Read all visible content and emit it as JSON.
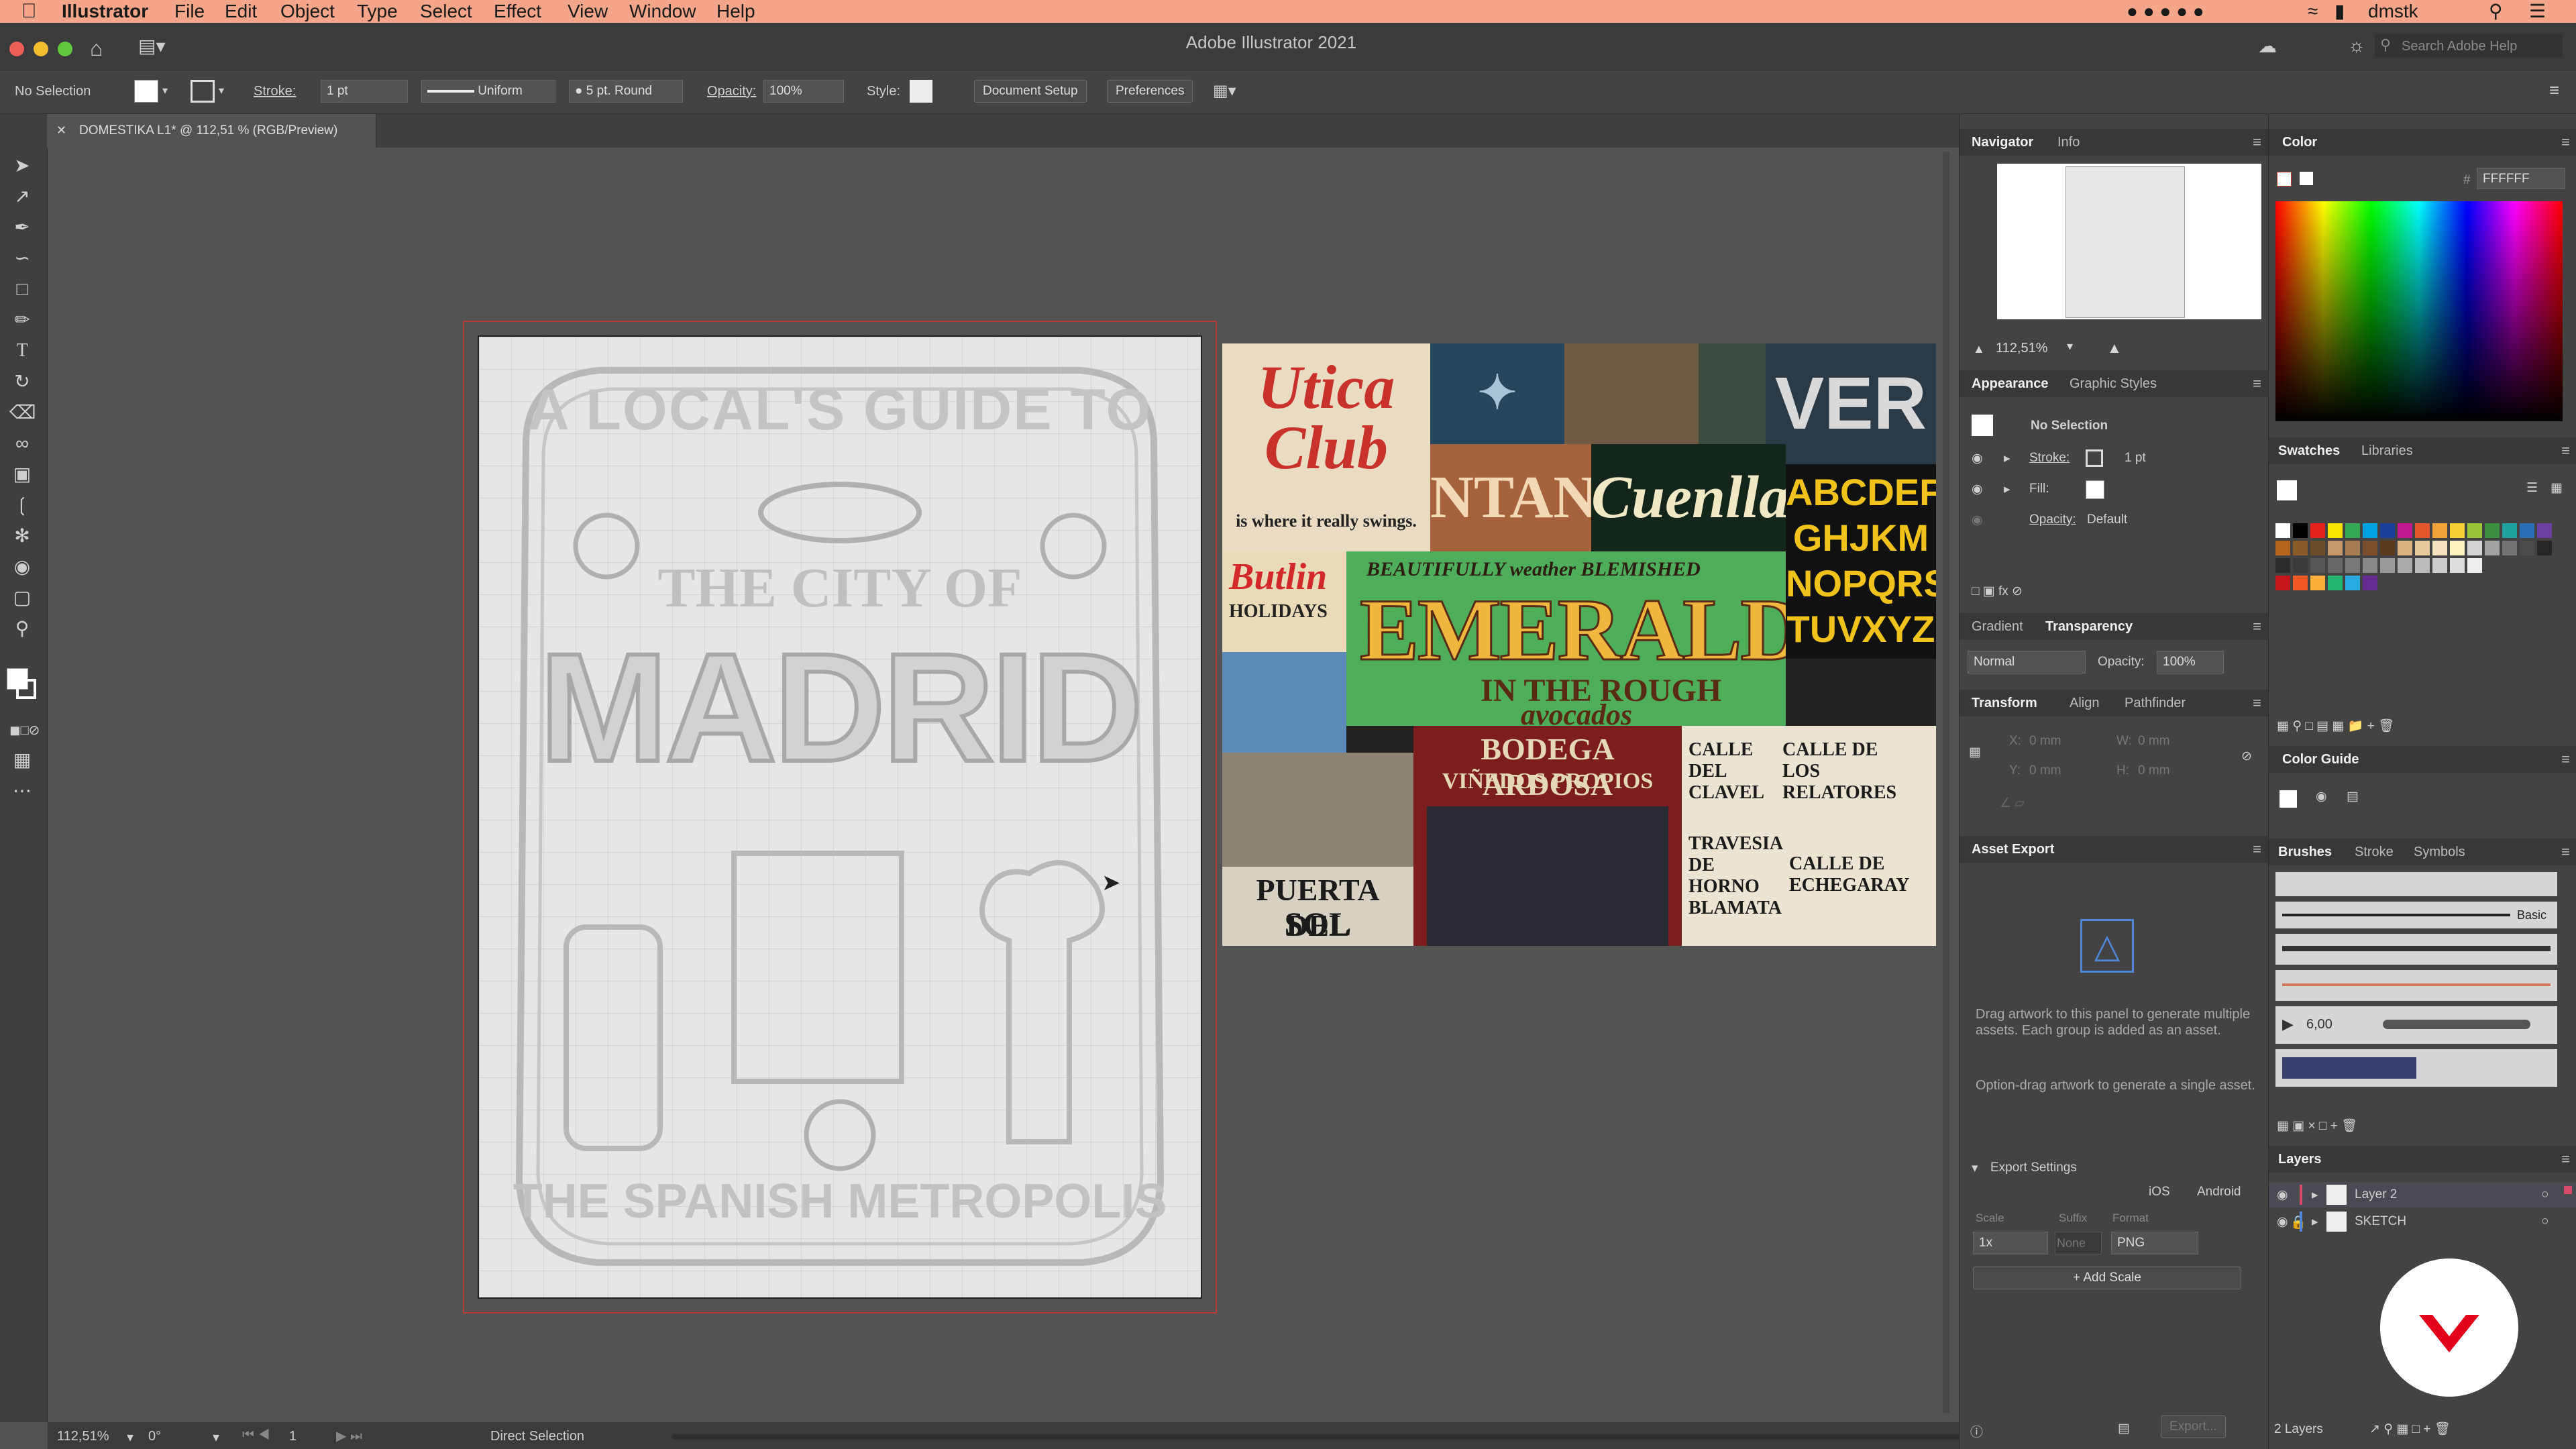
{
  "menubar": {
    "app": "Illustrator",
    "items": [
      "File",
      "Edit",
      "Object",
      "Type",
      "Select",
      "Effect",
      "View",
      "Window",
      "Help"
    ],
    "user": "dmstk"
  },
  "window": {
    "title": "Adobe Illustrator 2021",
    "search_placeholder": "Search Adobe Help"
  },
  "controlbar": {
    "selection": "No Selection",
    "stroke_label": "Stroke:",
    "stroke_value": "1 pt",
    "profile": "Uniform",
    "brush": "5 pt. Round",
    "opacity_label": "Opacity:",
    "opacity_value": "100%",
    "style_label": "Style:",
    "doc_setup": "Document Setup",
    "preferences": "Preferences"
  },
  "document_tab": {
    "title": "DOMESTIKA L1* @ 112,51 % (RGB/Preview)"
  },
  "artwork": {
    "line1": "A LOCAL'S GUIDE TO",
    "line2": "THE CITY OF",
    "line3": "MADRID",
    "line4": "THE SPANISH METROPOLIS"
  },
  "collage": {
    "utica": "Utica Club",
    "utica_tag": "is where it really swings.",
    "emeralds": "EMERALDS",
    "emeralds_top": "BEAUTIFULLY weather BLEMISHED",
    "emeralds_sub": "IN THE ROUGH",
    "emeralds_bottom": "avocados",
    "alphabet1": "ABCDEF",
    "alphabet2": "GHJKM",
    "alphabet3": "NOPQRS",
    "alphabet4": "TUVXYZ",
    "butlin": "Butlin",
    "butlin_sub": "HOLIDAYS",
    "puerta1": "PUERTA DEL",
    "puerta2": "SOL",
    "bodega": "BODEGA ARDOSA",
    "vinedos": "VIÑEDOS PROPIOS",
    "calle1": "CALLE DEL CLAVEL",
    "calle2": "CALLE DE LOS RELATORES",
    "calle3": "CALLE DE ECHEGARAY",
    "travesia": "TRAVESIA DE HORNO BLAMATA",
    "cuenlla": "Cuenlla",
    "ntane": "NTANE",
    "ver": "VER"
  },
  "navigator": {
    "tabs": [
      "Navigator",
      "Info"
    ],
    "zoom": "112,51%"
  },
  "appearance": {
    "tabs": [
      "Appearance",
      "Graphic Styles"
    ],
    "title": "No Selection",
    "stroke_label": "Stroke:",
    "stroke_value": "1 pt",
    "fill_label": "Fill:",
    "opacity_label": "Opacity:",
    "opacity_value": "Default"
  },
  "transparency": {
    "tabs": [
      "Gradient",
      "Transparency"
    ],
    "mode": "Normal",
    "opacity_label": "Opacity:",
    "opacity_value": "100%"
  },
  "transform": {
    "tabs": [
      "Transform",
      "Align",
      "Pathfinder"
    ],
    "x": "X:",
    "y": "Y:",
    "w": "W:",
    "h": "H:",
    "x_val": "0 mm",
    "y_val": "0 mm",
    "w_val": "0 mm",
    "h_val": "0 mm"
  },
  "asset_export": {
    "title": "Asset Export",
    "msg1": "Drag artwork to this panel to generate multiple assets. Each group is added as an asset.",
    "msg2": "Option-drag artwork to generate a single asset.",
    "settings": "Export Settings",
    "ios": "iOS",
    "android": "Android",
    "scale_label": "Scale",
    "suffix_label": "Suffix",
    "format_label": "Format",
    "scale": "1x",
    "suffix_placeholder": "None",
    "format": "PNG",
    "add_scale": "Add Scale",
    "export": "Export..."
  },
  "color": {
    "title": "Color",
    "hex_prefix": "#",
    "hex": "FFFFFF"
  },
  "swatches": {
    "tabs": [
      "Swatches",
      "Libraries"
    ]
  },
  "color_guide": {
    "title": "Color Guide"
  },
  "brushes": {
    "tabs": [
      "Brushes",
      "Stroke",
      "Symbols"
    ],
    "basic": "Basic",
    "size": "6,00"
  },
  "layers": {
    "title": "Layers",
    "items": [
      {
        "name": "Layer 2"
      },
      {
        "name": "SKETCH"
      }
    ],
    "count": "2 Layers"
  },
  "statusbar": {
    "zoom": "112,51%",
    "rotation": "0°",
    "page": "1",
    "tool": "Direct Selection"
  },
  "colors": {
    "menubar": "#f4a58a",
    "accent": "#2d86e0",
    "bleed": "#b63a3a",
    "domestika": "#e3001b"
  }
}
